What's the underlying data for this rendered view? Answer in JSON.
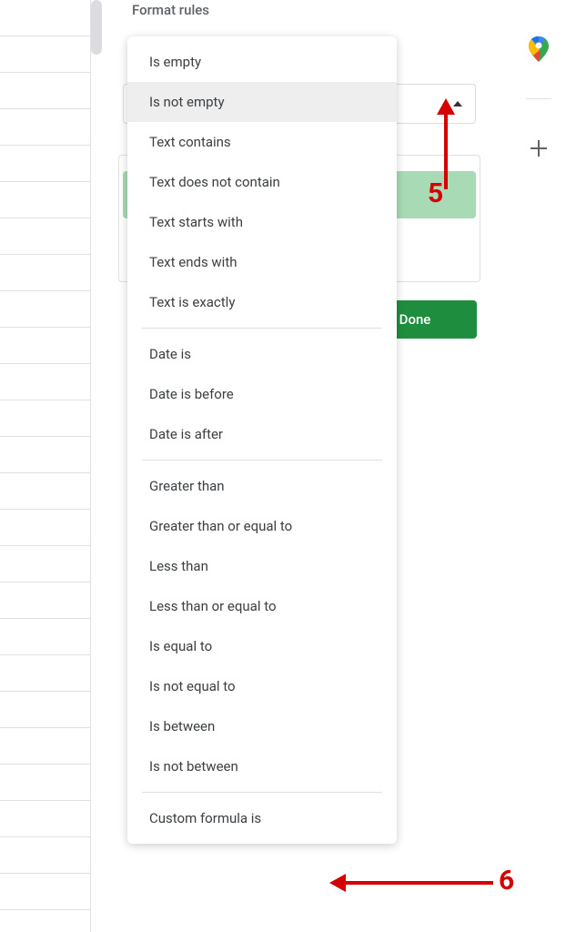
{
  "panel": {
    "title": "Format rules"
  },
  "behind": {
    "done_label": "Done"
  },
  "dropdown": {
    "groups": [
      {
        "items": [
          {
            "label": "Is empty",
            "selected": false
          },
          {
            "label": "Is not empty",
            "selected": true
          },
          {
            "label": "Text contains",
            "selected": false
          },
          {
            "label": "Text does not contain",
            "selected": false
          },
          {
            "label": "Text starts with",
            "selected": false
          },
          {
            "label": "Text ends with",
            "selected": false
          },
          {
            "label": "Text is exactly",
            "selected": false
          }
        ]
      },
      {
        "items": [
          {
            "label": "Date is",
            "selected": false
          },
          {
            "label": "Date is before",
            "selected": false
          },
          {
            "label": "Date is after",
            "selected": false
          }
        ]
      },
      {
        "items": [
          {
            "label": "Greater than",
            "selected": false
          },
          {
            "label": "Greater than or equal to",
            "selected": false
          },
          {
            "label": "Less than",
            "selected": false
          },
          {
            "label": "Less than or equal to",
            "selected": false
          },
          {
            "label": "Is equal to",
            "selected": false
          },
          {
            "label": "Is not equal to",
            "selected": false
          },
          {
            "label": "Is between",
            "selected": false
          },
          {
            "label": "Is not between",
            "selected": false
          }
        ]
      },
      {
        "items": [
          {
            "label": "Custom formula is",
            "selected": false
          }
        ]
      }
    ]
  },
  "annotations": {
    "a5": "5",
    "a6": "6"
  },
  "right_toolbar": {
    "maps": "maps-icon",
    "plus": "plus-icon"
  },
  "colors": {
    "accent_green": "#1e8e3e",
    "preview_green": "#a8dab5",
    "red": "#d50000"
  }
}
